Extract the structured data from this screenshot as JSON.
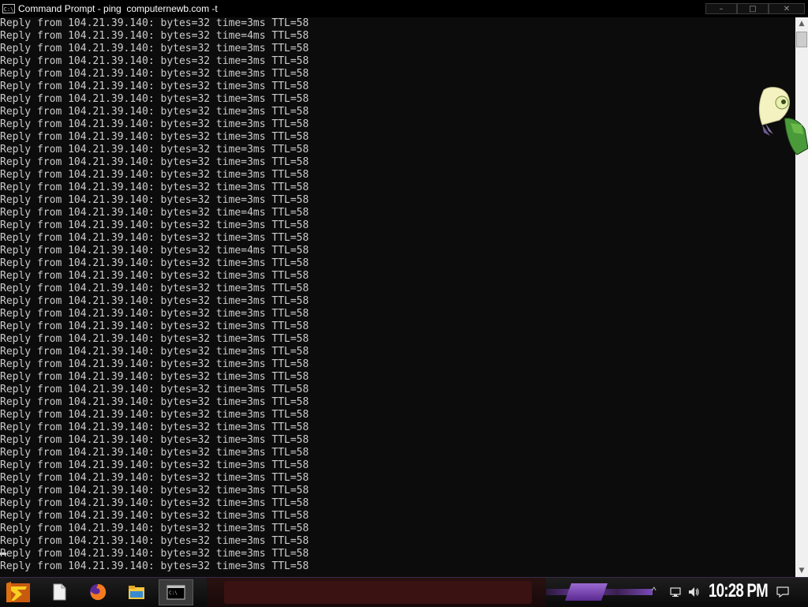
{
  "window": {
    "title": "Command Prompt - ping  computernewb.com -t",
    "icon": "cmd-icon",
    "icon_text": "C:\\",
    "controls": {
      "minimize": "–",
      "maximize": "□",
      "close": "✕"
    }
  },
  "console": {
    "text_color": "#cccccc",
    "background": "#0c0c0c",
    "lines": [
      "Reply from 104.21.39.140: bytes=32 time=3ms TTL=58",
      "Reply from 104.21.39.140: bytes=32 time=4ms TTL=58",
      "Reply from 104.21.39.140: bytes=32 time=3ms TTL=58",
      "Reply from 104.21.39.140: bytes=32 time=3ms TTL=58",
      "Reply from 104.21.39.140: bytes=32 time=3ms TTL=58",
      "Reply from 104.21.39.140: bytes=32 time=3ms TTL=58",
      "Reply from 104.21.39.140: bytes=32 time=3ms TTL=58",
      "Reply from 104.21.39.140: bytes=32 time=3ms TTL=58",
      "Reply from 104.21.39.140: bytes=32 time=3ms TTL=58",
      "Reply from 104.21.39.140: bytes=32 time=3ms TTL=58",
      "Reply from 104.21.39.140: bytes=32 time=3ms TTL=58",
      "Reply from 104.21.39.140: bytes=32 time=3ms TTL=58",
      "Reply from 104.21.39.140: bytes=32 time=3ms TTL=58",
      "Reply from 104.21.39.140: bytes=32 time=3ms TTL=58",
      "Reply from 104.21.39.140: bytes=32 time=3ms TTL=58",
      "Reply from 104.21.39.140: bytes=32 time=4ms TTL=58",
      "Reply from 104.21.39.140: bytes=32 time=3ms TTL=58",
      "Reply from 104.21.39.140: bytes=32 time=3ms TTL=58",
      "Reply from 104.21.39.140: bytes=32 time=4ms TTL=58",
      "Reply from 104.21.39.140: bytes=32 time=3ms TTL=58",
      "Reply from 104.21.39.140: bytes=32 time=3ms TTL=58",
      "Reply from 104.21.39.140: bytes=32 time=3ms TTL=58",
      "Reply from 104.21.39.140: bytes=32 time=3ms TTL=58",
      "Reply from 104.21.39.140: bytes=32 time=3ms TTL=58",
      "Reply from 104.21.39.140: bytes=32 time=3ms TTL=58",
      "Reply from 104.21.39.140: bytes=32 time=3ms TTL=58",
      "Reply from 104.21.39.140: bytes=32 time=3ms TTL=58",
      "Reply from 104.21.39.140: bytes=32 time=3ms TTL=58",
      "Reply from 104.21.39.140: bytes=32 time=3ms TTL=58",
      "Reply from 104.21.39.140: bytes=32 time=3ms TTL=58",
      "Reply from 104.21.39.140: bytes=32 time=3ms TTL=58",
      "Reply from 104.21.39.140: bytes=32 time=3ms TTL=58",
      "Reply from 104.21.39.140: bytes=32 time=3ms TTL=58",
      "Reply from 104.21.39.140: bytes=32 time=3ms TTL=58",
      "Reply from 104.21.39.140: bytes=32 time=3ms TTL=58",
      "Reply from 104.21.39.140: bytes=32 time=3ms TTL=58",
      "Reply from 104.21.39.140: bytes=32 time=3ms TTL=58",
      "Reply from 104.21.39.140: bytes=32 time=3ms TTL=58",
      "Reply from 104.21.39.140: bytes=32 time=3ms TTL=58",
      "Reply from 104.21.39.140: bytes=32 time=3ms TTL=58",
      "Reply from 104.21.39.140: bytes=32 time=3ms TTL=58",
      "Reply from 104.21.39.140: bytes=32 time=3ms TTL=58",
      "Reply from 104.21.39.140: bytes=32 time=3ms TTL=58",
      "Reply from 104.21.39.140: bytes=32 time=3ms TTL=58"
    ]
  },
  "scrollbar": {
    "up_arrow": "▲",
    "down_arrow": "▼"
  },
  "desktop_mascot": {
    "icon": "mascot-character-icon"
  },
  "taskbar": {
    "start_icon": "start-menu-icon",
    "pinned": [
      {
        "name": "file-icon"
      },
      {
        "name": "firefox-icon"
      },
      {
        "name": "file-explorer-icon"
      },
      {
        "name": "command-prompt-icon",
        "active": true
      }
    ],
    "tray": {
      "chevron": "^",
      "network_icon": "network-icon",
      "volume_icon": "volume-icon",
      "notification_icon": "notification-icon"
    },
    "clock": "10:28 PM",
    "accent_color": "#7a4ab8"
  }
}
